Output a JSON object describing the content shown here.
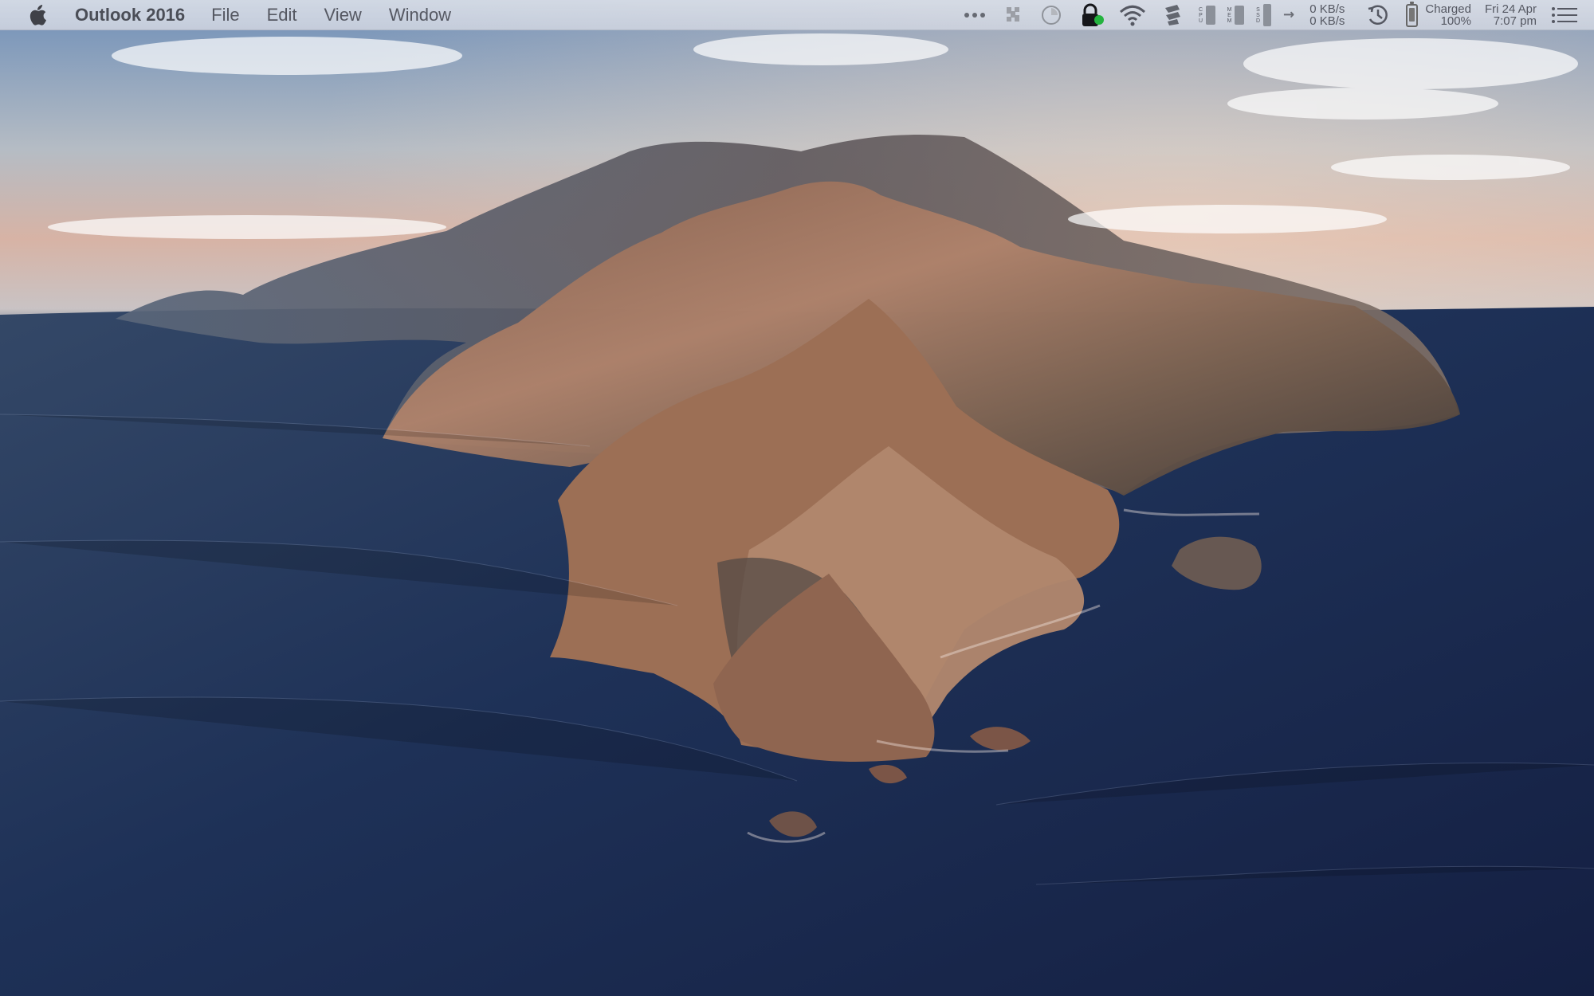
{
  "menu": {
    "app_name": "Outlook 2016",
    "items": [
      "File",
      "Edit",
      "View",
      "Window"
    ]
  },
  "status": {
    "cpu_label": [
      "C",
      "P",
      "U"
    ],
    "mem_label": [
      "M",
      "E",
      "M"
    ],
    "ssd_label": [
      "S",
      "S",
      "D"
    ],
    "network_up": "0 KB/s",
    "network_down": "0 KB/s",
    "battery_status": "Charged",
    "battery_percent": "100%",
    "date": "Fri 24 Apr",
    "time": "7:07 pm"
  },
  "icons": {
    "apple": "apple-icon",
    "more": "more-icon",
    "puzzle": "puzzle-icon",
    "clock": "timer-icon",
    "lock": "lock-icon",
    "wifi": "wifi-icon",
    "grid": "grid-icon",
    "network_arrows": "network-arrows-icon",
    "time_machine": "time-machine-icon",
    "battery": "battery-icon",
    "notification": "notification-center-icon"
  },
  "colors": {
    "menubar": "#d8dde6",
    "text": "#555862",
    "green_status": "#24b33f",
    "sea_dark": "#1c2a4c",
    "rock": "#9a6b4f"
  }
}
